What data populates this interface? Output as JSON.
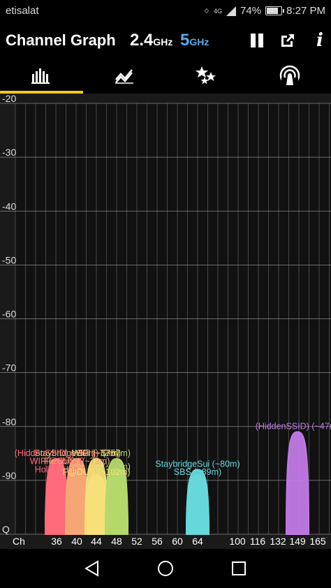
{
  "status_bar": {
    "carrier": "etisalat",
    "battery": "74%",
    "time": "8:27 PM",
    "network": "4G"
  },
  "app_bar": {
    "title": "Channel Graph",
    "band_24": "2.4",
    "band_24_unit": "GHz",
    "band_5": "5",
    "band_5_unit": "GHz",
    "info_label": "i"
  },
  "tabs": [
    {
      "name": "channel-graph",
      "icon": "bar-chart-icon",
      "active": true
    },
    {
      "name": "time-graph",
      "icon": "line-graph-icon",
      "active": false
    },
    {
      "name": "channel-rating",
      "icon": "stars-icon",
      "active": false
    },
    {
      "name": "access-points",
      "icon": "wifi-signal-icon",
      "active": false
    }
  ],
  "chart_data": {
    "type": "area",
    "y_ticks": [
      "-20",
      "-30",
      "-40",
      "-50",
      "-60",
      "-70",
      "-80",
      "-90",
      "Q"
    ],
    "ylim": [
      -100,
      -20
    ],
    "x_label": "Ch",
    "x_ticks": [
      "36",
      "40",
      "44",
      "48",
      "52",
      "56",
      "60",
      "64",
      "100",
      "116",
      "132",
      "149",
      "165"
    ],
    "grid": true,
    "networks": [
      {
        "name": "(HiddenSSID) (~53m)",
        "channel": "36",
        "level": -86,
        "color": "#ff6b7a"
      },
      {
        "name": "WIFI@DUSIT",
        "channel": "36",
        "level": -87,
        "color": "#ff6b7a"
      },
      {
        "name": "Holiday Inn",
        "channel": "36",
        "level": -88,
        "color": "#ff6b7a"
      },
      {
        "name": "StaybridgeSui (~72m)",
        "channel": "40",
        "level": -86,
        "color": "#f4a774"
      },
      {
        "name": "Flexibility (~72m)",
        "channel": "40",
        "level": -87,
        "color": "#f4a774"
      },
      {
        "name": "WIFI (~57m)",
        "channel": "44",
        "level": -86,
        "color": "#f7e07a"
      },
      {
        "name": "F@DUS (~102m)",
        "channel": "44",
        "level": -89,
        "color": "#f7e07a"
      },
      {
        "name": "(~57m)",
        "channel": "48",
        "level": -86,
        "color": "#b5d86a"
      },
      {
        "name": "(~50m)",
        "channel": "48",
        "level": -88,
        "color": "#b5d86a"
      },
      {
        "name": "StaybridgeSui (~80m)",
        "channel": "64",
        "level": -88,
        "color": "#66d8dc"
      },
      {
        "name": "SBS (~89m)",
        "channel": "64",
        "level": -89,
        "color": "#66d8dc"
      },
      {
        "name": "(HiddenSSID) (~47m)",
        "channel": "149",
        "level": -81,
        "color": "#c27ae6"
      }
    ]
  }
}
